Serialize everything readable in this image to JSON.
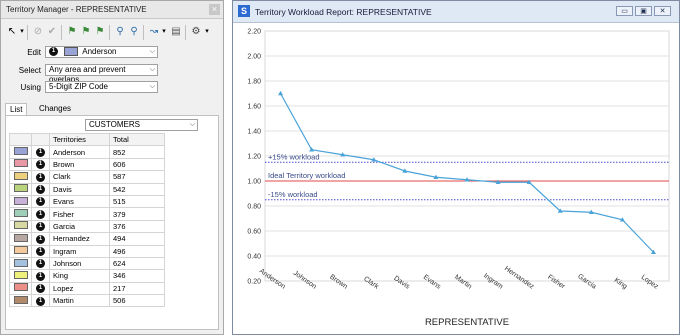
{
  "manager": {
    "title": "Territory Manager - REPRESENTATIVE",
    "close_glyph": "×",
    "edit_label": "Edit",
    "edit_value": "Anderson",
    "edit_badge": "1",
    "select_label": "Select",
    "select_value": "Any area and prevent overlaps",
    "using_label": "Using",
    "using_value": "5-Digit ZIP Code",
    "tab_list": "List",
    "tab_changes": "Changes",
    "layer_value": "CUSTOMERS",
    "col_territories": "Territories",
    "col_total": "Total",
    "rows": [
      {
        "name": "Anderson",
        "total": "852",
        "color": "#9aa3d6",
        "badge": "1"
      },
      {
        "name": "Brown",
        "total": "606",
        "color": "#e79aa6",
        "badge": "1"
      },
      {
        "name": "Clark",
        "total": "587",
        "color": "#ecd07c",
        "badge": "1"
      },
      {
        "name": "Davis",
        "total": "542",
        "color": "#b9d47a",
        "badge": "1"
      },
      {
        "name": "Evans",
        "total": "515",
        "color": "#c7b1d9",
        "badge": "1"
      },
      {
        "name": "Fisher",
        "total": "379",
        "color": "#9fcfb9",
        "badge": "1"
      },
      {
        "name": "Garcia",
        "total": "376",
        "color": "#d8d9a2",
        "badge": "1"
      },
      {
        "name": "Hernandez",
        "total": "494",
        "color": "#b7a7a3",
        "badge": "1"
      },
      {
        "name": "Ingram",
        "total": "496",
        "color": "#f2c89c",
        "badge": "1"
      },
      {
        "name": "Johnson",
        "total": "624",
        "color": "#a4c2e0",
        "badge": "1"
      },
      {
        "name": "King",
        "total": "346",
        "color": "#eef07e",
        "badge": "1"
      },
      {
        "name": "Lopez",
        "total": "217",
        "color": "#ec8f88",
        "badge": "1"
      },
      {
        "name": "Martin",
        "total": "506",
        "color": "#b08a6a",
        "badge": "1"
      }
    ]
  },
  "report": {
    "title": "Territory Workload Report: REPRESENTATIVE",
    "icon_glyph": "S",
    "btn_min": "▭",
    "btn_max": "▣",
    "btn_close": "✕"
  },
  "chart_data": {
    "type": "line",
    "categories": [
      "Anderson",
      "Johnson",
      "Brown",
      "Clark",
      "Davis",
      "Evans",
      "Martin",
      "Ingram",
      "Hernandez",
      "Fisher",
      "Garcia",
      "King",
      "Lopez"
    ],
    "values": [
      1.7,
      1.25,
      1.21,
      1.17,
      1.08,
      1.03,
      1.01,
      0.99,
      0.99,
      0.76,
      0.75,
      0.69,
      0.43
    ],
    "xlabel": "REPRESENTATIVE",
    "ylim": [
      0.2,
      2.2
    ],
    "yticks": [
      "0.20",
      "0.40",
      "0.60",
      "0.80",
      "1.00",
      "1.20",
      "1.40",
      "1.60",
      "1.80",
      "2.00",
      "2.20"
    ],
    "grid": true,
    "series_color": "#4aa3d8",
    "reference_lines": [
      {
        "label": "+15% workload",
        "value": 1.15,
        "color": "#4a4acc",
        "style": "dotted"
      },
      {
        "label": "Ideal Territory workload",
        "value": 1.0,
        "color": "#e04848",
        "style": "solid"
      },
      {
        "label": "-15% workload",
        "value": 0.85,
        "color": "#4a4acc",
        "style": "dotted"
      }
    ]
  }
}
